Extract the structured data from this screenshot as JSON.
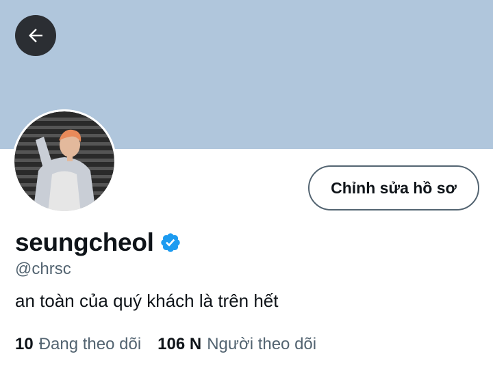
{
  "colors": {
    "banner": "#b0c6dc",
    "verified": "#1d9bf0",
    "text_primary": "#0f1419",
    "text_secondary": "#536471"
  },
  "header": {
    "back_icon": "arrow-left-icon"
  },
  "profile": {
    "display_name": "seungcheol",
    "verified_icon": "verified-badge-icon",
    "handle": "@chrsc",
    "bio": "an toàn của quý khách là trên hết",
    "edit_button_label": "Chỉnh sửa hồ sơ"
  },
  "stats": {
    "following_count": "10",
    "following_label": "Đang theo dõi",
    "followers_count": "106 N",
    "followers_label": "Người theo dõi"
  }
}
